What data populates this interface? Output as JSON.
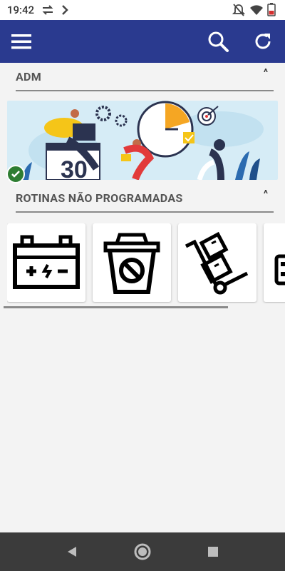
{
  "status_bar": {
    "time": "19:42"
  },
  "sections": [
    {
      "title": "ADM",
      "chevron": "^"
    },
    {
      "title": "ROTINAS NÃO PROGRAMADAS",
      "chevron": "^"
    }
  ],
  "cards": [
    {
      "icon": "battery-icon"
    },
    {
      "icon": "no-trash-icon"
    },
    {
      "icon": "hand-truck-icon"
    },
    {
      "icon": "partial-card-icon"
    }
  ],
  "colors": {
    "app_bar": "#2a3a8f",
    "nav_bar": "#3b3b3b",
    "badge": "#2e7d32"
  }
}
